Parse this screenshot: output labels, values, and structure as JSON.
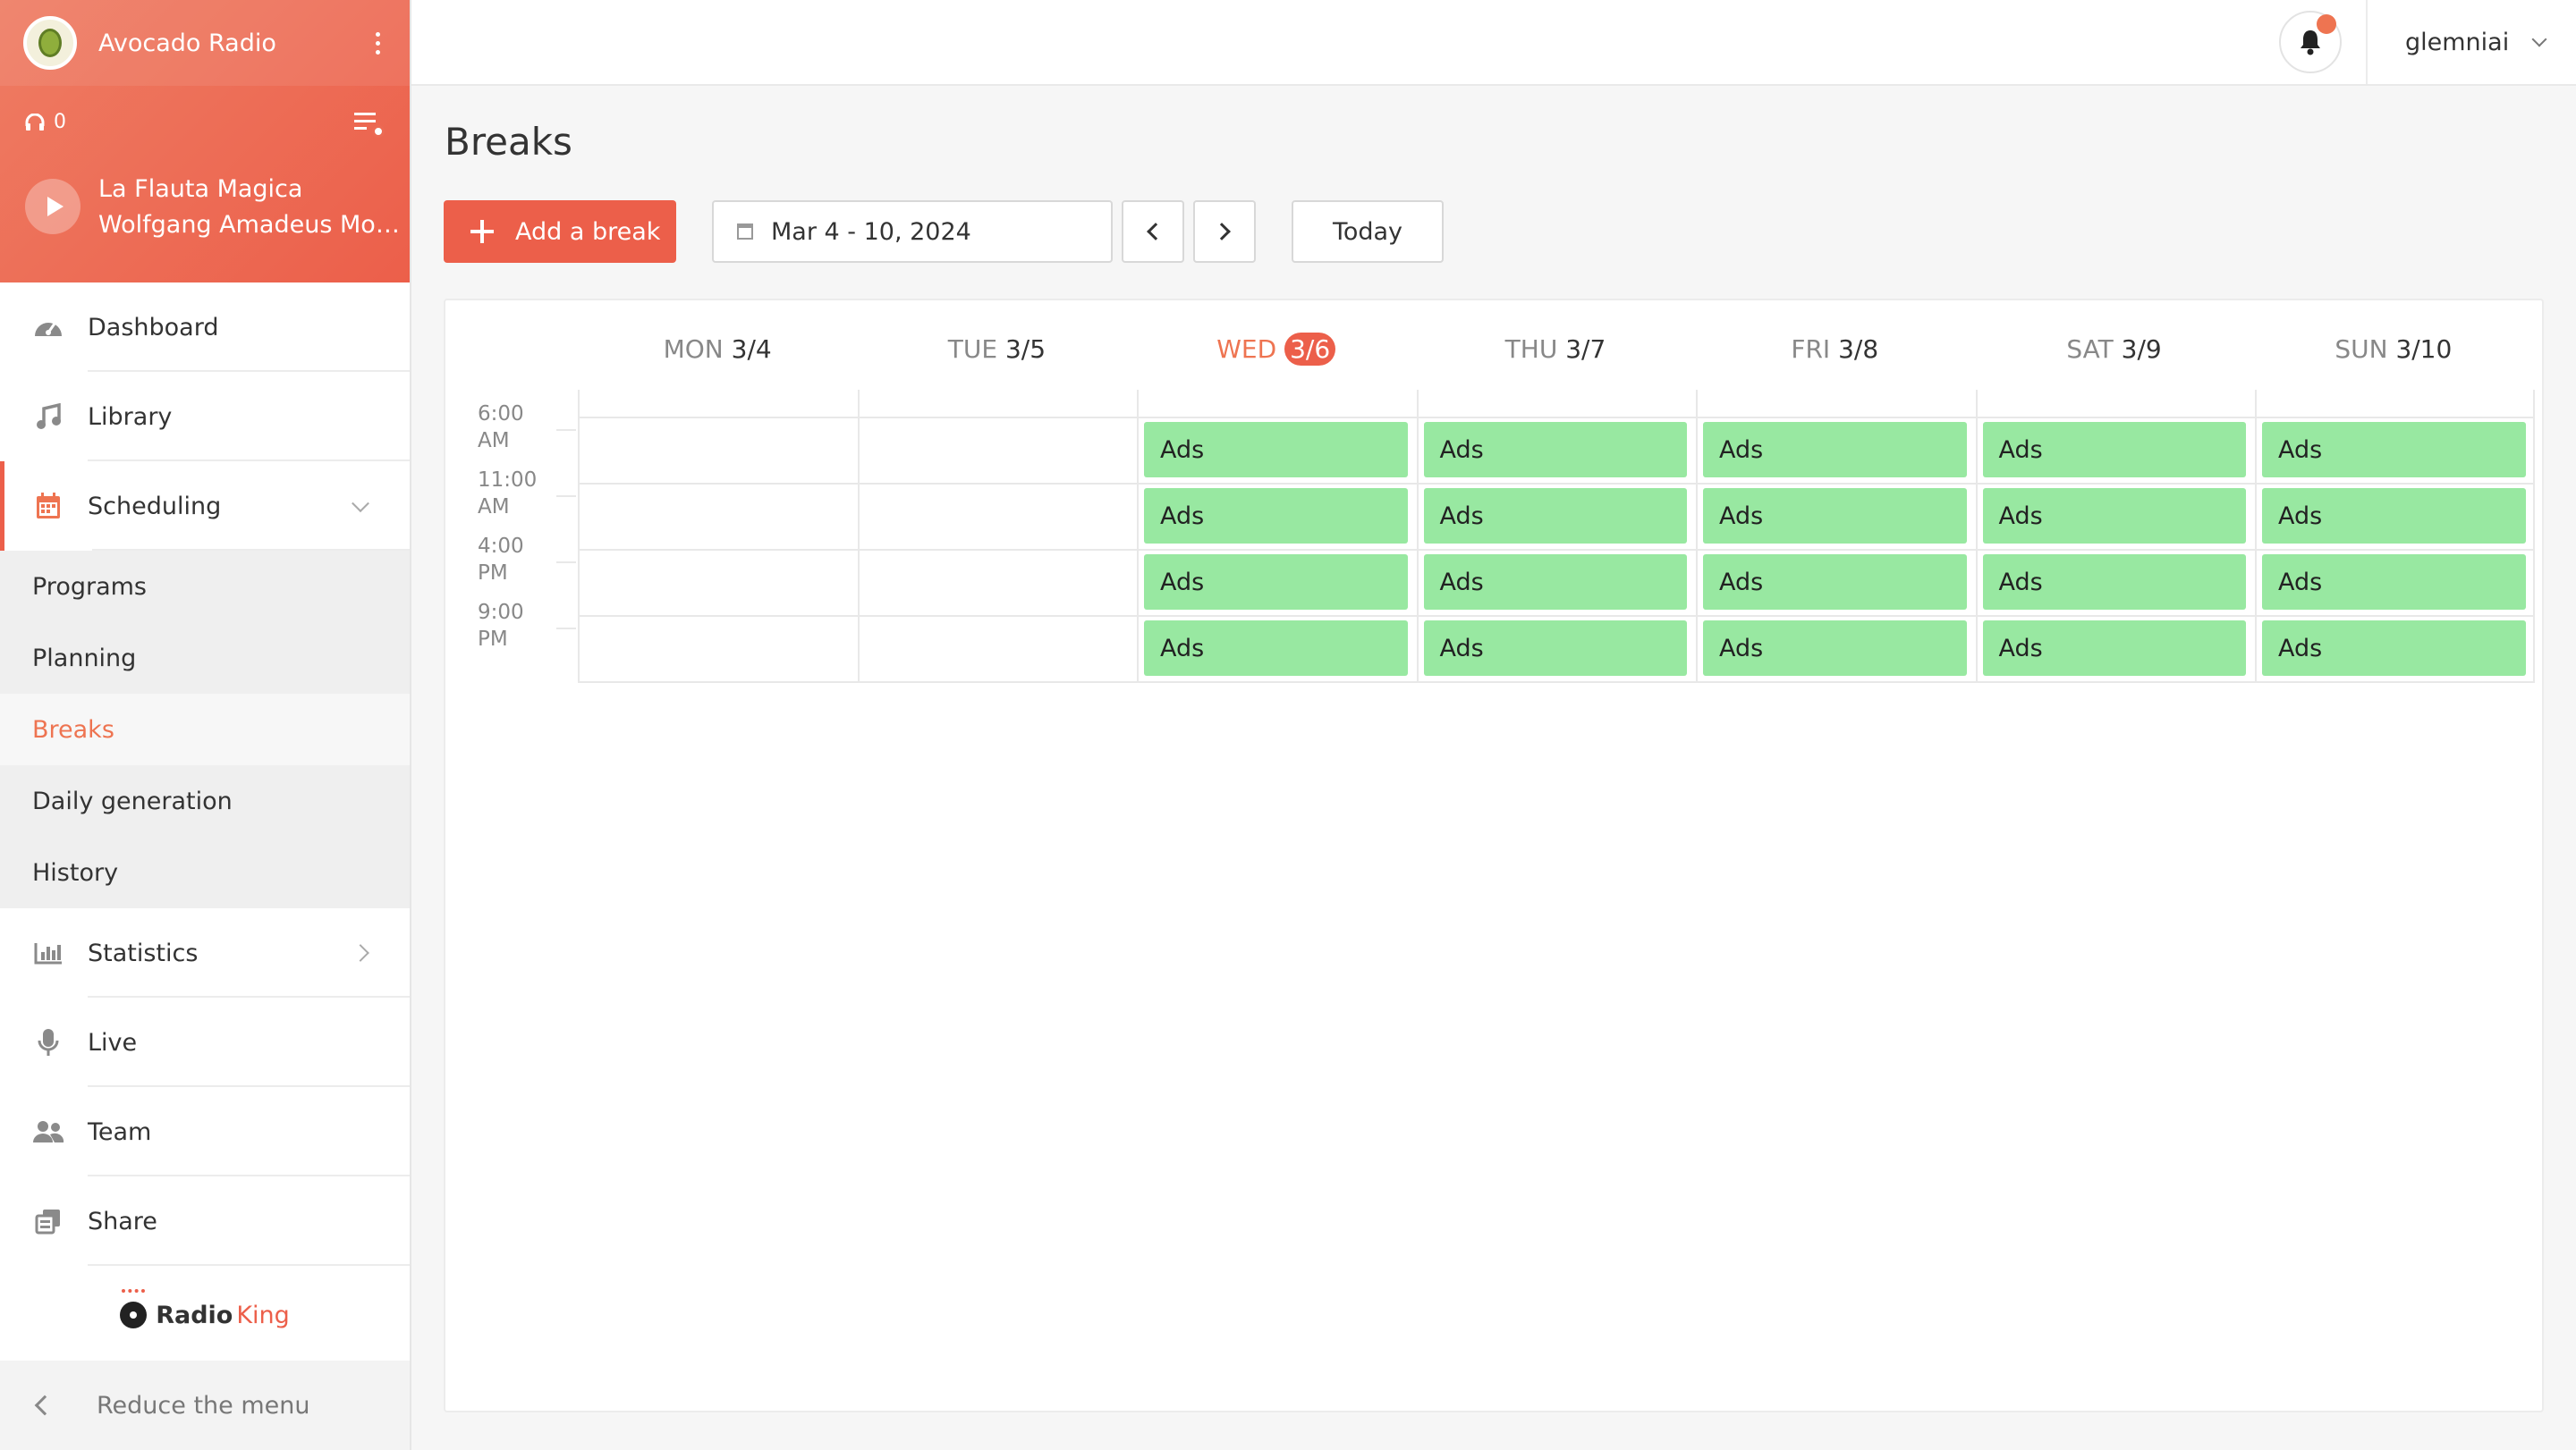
{
  "sidebar": {
    "station_name": "Avocado Radio",
    "listeners": "0",
    "now_playing": {
      "title": "La Flauta Magica",
      "artist": "Wolfgang Amadeus Moz..."
    },
    "menu": [
      {
        "label": "Dashboard",
        "icon": "dashboard-icon"
      },
      {
        "label": "Library",
        "icon": "music-note-icon"
      },
      {
        "label": "Scheduling",
        "icon": "calendar-icon"
      },
      {
        "label": "Statistics",
        "icon": "bar-chart-icon"
      },
      {
        "label": "Live",
        "icon": "microphone-icon"
      },
      {
        "label": "Team",
        "icon": "users-icon"
      },
      {
        "label": "Share",
        "icon": "share-icon"
      }
    ],
    "submenu": [
      "Programs",
      "Planning",
      "Breaks",
      "Daily generation",
      "History"
    ],
    "brand": {
      "part1": "Radio",
      "part2": "King"
    },
    "reduce_label": "Reduce the menu"
  },
  "header": {
    "username": "glemniai"
  },
  "page": {
    "title": "Breaks",
    "add_label": "Add a break",
    "date_range": "Mar 4 - 10, 2024",
    "today_label": "Today"
  },
  "calendar": {
    "days": [
      {
        "name": "MON",
        "date": "3/4"
      },
      {
        "name": "TUE",
        "date": "3/5"
      },
      {
        "name": "WED",
        "date": "3/6"
      },
      {
        "name": "THU",
        "date": "3/7"
      },
      {
        "name": "FRI",
        "date": "3/8"
      },
      {
        "name": "SAT",
        "date": "3/9"
      },
      {
        "name": "SUN",
        "date": "3/10"
      }
    ],
    "today_index": 2,
    "times": [
      {
        "time": "6:00",
        "period": "AM"
      },
      {
        "time": "11:00",
        "period": "AM"
      },
      {
        "time": "4:00",
        "period": "PM"
      },
      {
        "time": "9:00",
        "period": "PM"
      }
    ],
    "break_label": "Ads",
    "break_days": [
      2,
      3,
      4,
      5,
      6
    ],
    "colors": {
      "break": "#98e8a1",
      "accent": "#ec5f4a"
    }
  }
}
